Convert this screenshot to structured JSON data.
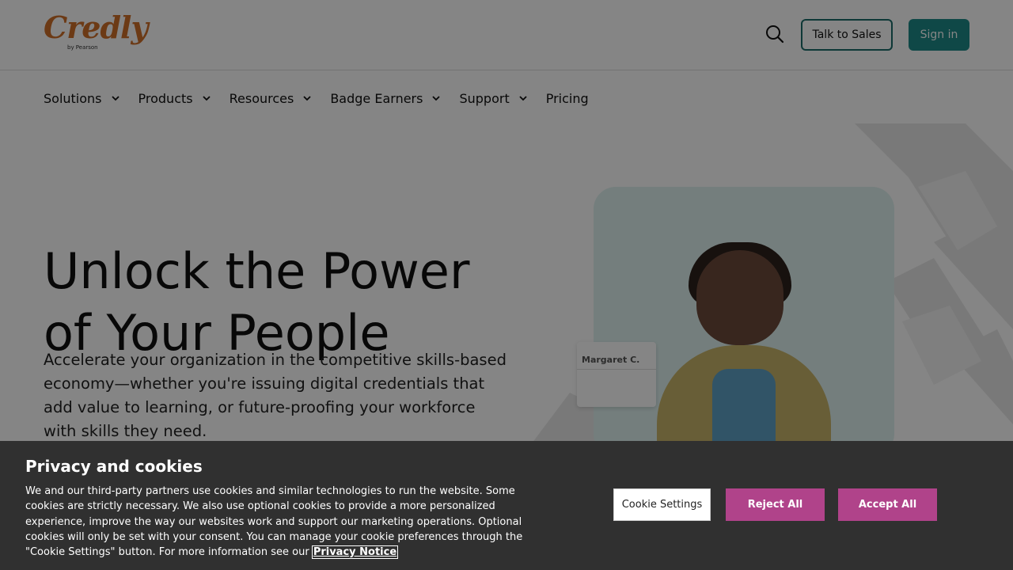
{
  "header": {
    "logo_text": "Credly",
    "logo_sub": "by Pearson",
    "talk_to_sales": "Talk to Sales",
    "sign_in": "Sign in"
  },
  "nav": {
    "items": [
      {
        "label": "Solutions",
        "dropdown": true
      },
      {
        "label": "Products",
        "dropdown": true
      },
      {
        "label": "Resources",
        "dropdown": true
      },
      {
        "label": "Badge Earners",
        "dropdown": true
      },
      {
        "label": "Support",
        "dropdown": true
      },
      {
        "label": "Pricing",
        "dropdown": false
      }
    ]
  },
  "hero": {
    "title_line1": "Unlock the Power",
    "title_line2": "of Your People",
    "text": "Accelerate your organization in the competitive skills-based economy—whether you're issuing digital credentials that add value to learning, or future-proofing your workforce with skills they need.",
    "card_name": "Margaret C."
  },
  "cookie": {
    "title": "Privacy and cookies",
    "body": "We and our third-party partners use cookies and similar technologies to run the website. Some cookies are strictly necessary. We also use optional cookies to provide a more personalized experience, improve the way our websites work and support our marketing operations. Optional cookies will only be set with your consent. You can manage your cookie preferences through the \"Cookie Settings\" button. For more information see our",
    "privacy_link": "Privacy Notice",
    "settings": "Cookie Settings",
    "reject": "Reject All",
    "accept": "Accept All"
  },
  "colors": {
    "brand_orange": "#d06f2a",
    "teal": "#1d8b89",
    "cookie_bg": "#303030",
    "cookie_button": "#b0438a"
  }
}
